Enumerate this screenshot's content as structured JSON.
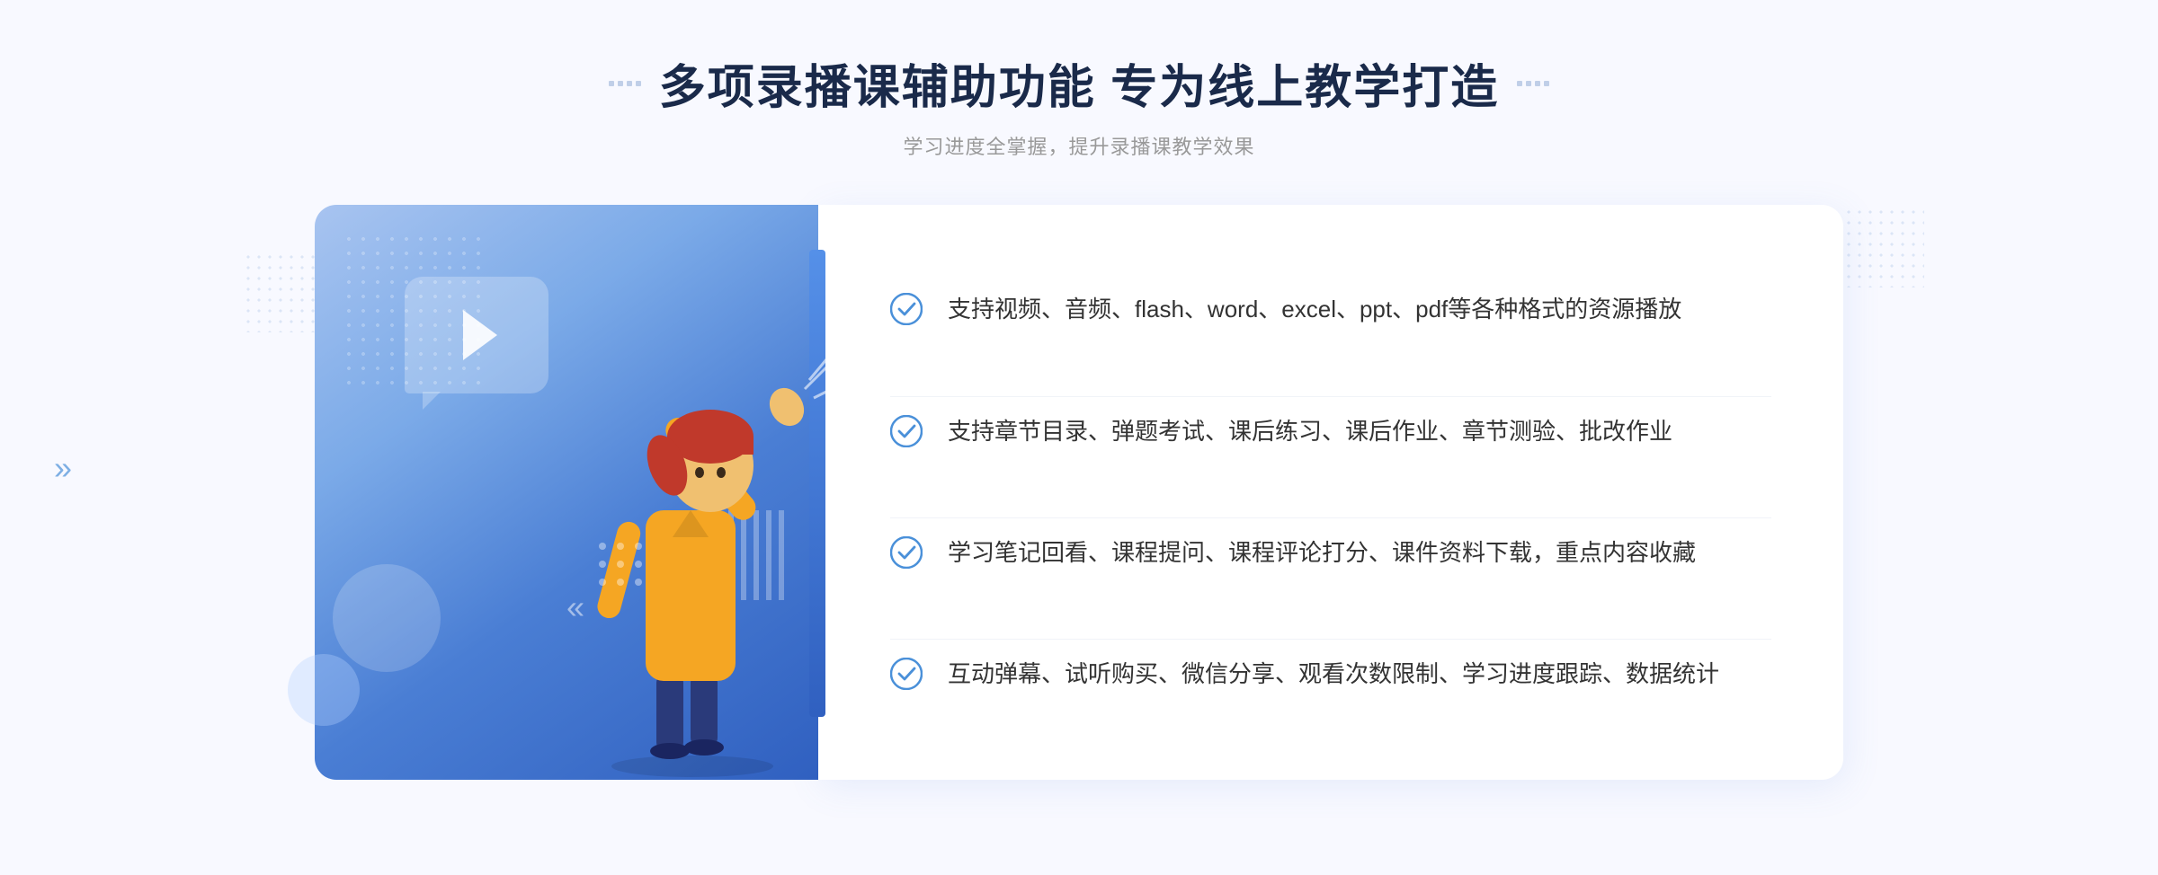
{
  "page": {
    "background_color": "#f8f9ff"
  },
  "header": {
    "title": "多项录播课辅助功能 专为线上教学打造",
    "subtitle": "学习进度全掌握，提升录播课教学效果",
    "title_decorator_dots": 4
  },
  "features": [
    {
      "id": 1,
      "text": "支持视频、音频、flash、word、excel、ppt、pdf等各种格式的资源播放"
    },
    {
      "id": 2,
      "text": "支持章节目录、弹题考试、课后练习、课后作业、章节测验、批改作业"
    },
    {
      "id": 3,
      "text": "学习笔记回看、课程提问、课程评论打分、课件资料下载，重点内容收藏"
    },
    {
      "id": 4,
      "text": "互动弹幕、试听购买、微信分享、观看次数限制、学习进度跟踪、数据统计"
    }
  ],
  "colors": {
    "title_color": "#1a2a4a",
    "subtitle_color": "#999999",
    "feature_text_color": "#333333",
    "check_color": "#4a90d9",
    "gradient_start": "#a8c4f0",
    "gradient_end": "#3060c0"
  },
  "decorations": {
    "arrow_left": "»",
    "play_icon": "▶"
  }
}
